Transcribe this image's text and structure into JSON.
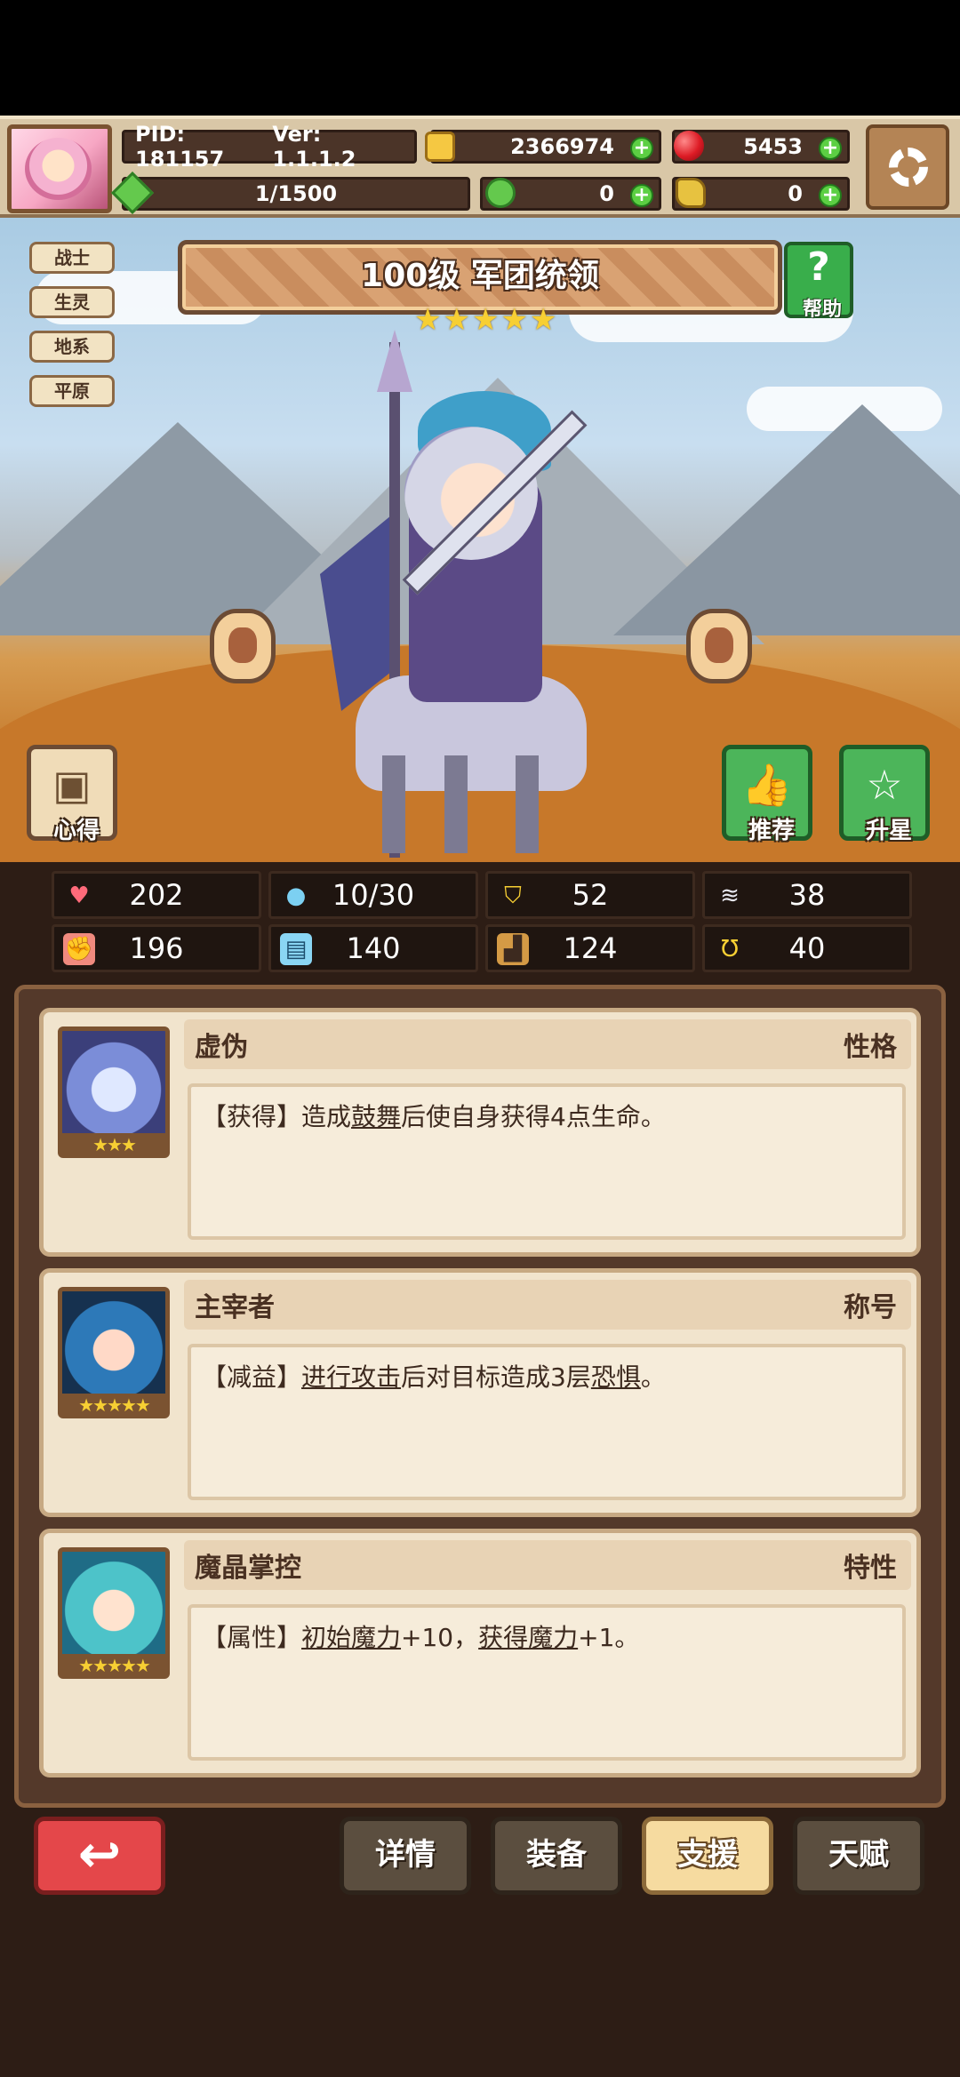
{
  "header": {
    "pid": "PID: 181157",
    "version": "Ver: 1.1.1.2",
    "coins": "2366974",
    "gems": "5453",
    "stamina": "1/1500",
    "clover": "0",
    "keys": "0"
  },
  "tags": [
    "战士",
    "生灵",
    "地系",
    "平原"
  ],
  "hero": {
    "title": "100级 军团统领",
    "star_count": 5,
    "help_label": "帮助"
  },
  "side_buttons": {
    "insight_label": "心得",
    "recommend_label": "推荐",
    "upgrade_star_label": "升星"
  },
  "stats": [
    {
      "icon": "heart-icon",
      "value": "202"
    },
    {
      "icon": "water-drop-icon",
      "value": "10/30"
    },
    {
      "icon": "shield-icon",
      "value": "52"
    },
    {
      "icon": "wing-icon",
      "value": "38"
    },
    {
      "icon": "fist-icon",
      "value": "196"
    },
    {
      "icon": "book-icon",
      "value": "140"
    },
    {
      "icon": "boot-icon",
      "value": "124"
    },
    {
      "icon": "horseshoe-icon",
      "value": "40"
    }
  ],
  "cards": [
    {
      "name": "虚伪",
      "kind": "性格",
      "stars": "★★★",
      "desc_prefix": "【获得】造成",
      "desc_link1": "鼓舞",
      "desc_mid": "后使自身获得4点生命。",
      "desc_link2": "",
      "desc_suffix": ""
    },
    {
      "name": "主宰者",
      "kind": "称号",
      "stars": "★★★★★",
      "desc_prefix": "【减益】",
      "desc_link1": "进行攻击",
      "desc_mid": "后对目标造成3层",
      "desc_link2": "恐惧",
      "desc_suffix": "。"
    },
    {
      "name": "魔晶掌控",
      "kind": "特性",
      "stars": "★★★★★",
      "desc_prefix": "【属性】",
      "desc_link1": "初始魔力",
      "desc_mid": "+10，",
      "desc_link2": "获得魔力",
      "desc_suffix": "+1。"
    }
  ],
  "nav": {
    "back_label": "↩",
    "tabs": [
      "详情",
      "装备",
      "支援",
      "天赋"
    ],
    "active_tab": "支援"
  },
  "colors": {
    "accent_green": "#4cb55a",
    "accent_red": "#e4474a",
    "panel_brown": "#54392a",
    "gold": "#f7cf33"
  }
}
